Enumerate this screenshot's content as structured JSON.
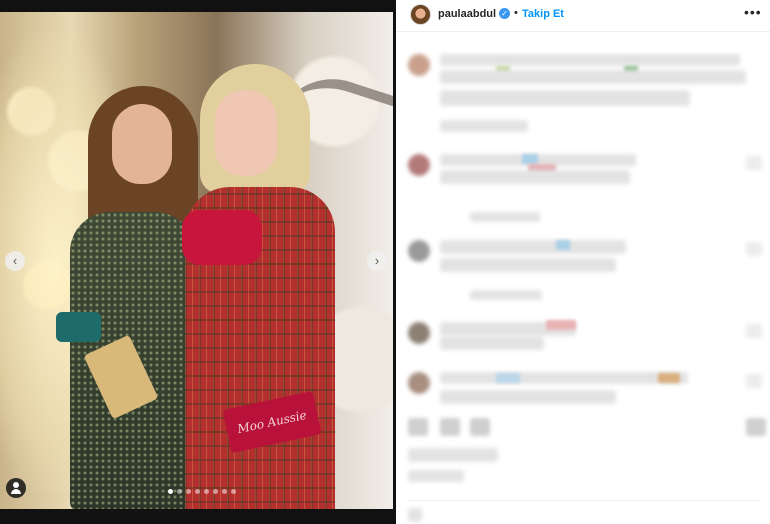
{
  "post": {
    "media": {
      "clutch_text": "Moo Aussie",
      "carousel": {
        "slide_count": 8,
        "active_index": 0
      },
      "prev_icon": "chevron-left-icon",
      "next_icon": "chevron-right-icon",
      "tag_icon": "user-tag-icon"
    },
    "header": {
      "username": "paulaabdul",
      "verified_icon": "verified-badge-icon",
      "separator": "•",
      "follow_label": "Takip Et",
      "more_icon": "more-icon",
      "more_glyph": "•••"
    },
    "comments_blurred": true
  },
  "colors": {
    "follow_blue": "#0095f6",
    "verified_blue": "#3897f0",
    "text_primary": "#262626"
  }
}
